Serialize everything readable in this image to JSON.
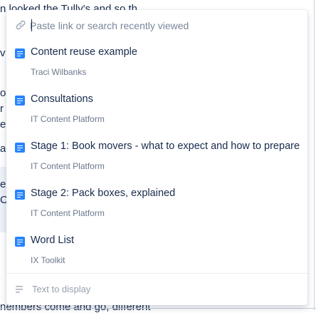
{
  "background": {
    "fragments": [
      {
        "text": "n looked the Tully's and so th"
      },
      {
        "text": "v"
      },
      {
        "text": "o"
      },
      {
        "text": "r"
      },
      {
        "text": "e"
      },
      {
        "text": "a"
      },
      {
        "text": "e,"
      },
      {
        "text": "C"
      },
      {
        "text": "nembers come and go, different"
      }
    ]
  },
  "search": {
    "placeholder": "Paste link or search recently viewed",
    "value": "",
    "icon": "link-icon"
  },
  "results": [
    {
      "title": "Content reuse example",
      "subtitle": "Traci Wilbanks",
      "icon": "page-icon"
    },
    {
      "title": "Consultations",
      "subtitle": "IT Content Platform",
      "icon": "page-icon"
    },
    {
      "title": "Stage 1: Book movers - what to expect and how to prepare",
      "subtitle": "IT Content Platform",
      "icon": "page-icon"
    },
    {
      "title": "Stage 2: Pack boxes, explained",
      "subtitle": "IT Content Platform",
      "icon": "page-icon"
    },
    {
      "title": "Word List",
      "subtitle": "IX Toolkit",
      "icon": "page-icon"
    }
  ],
  "display_text": {
    "placeholder": "Text to display",
    "value": "",
    "icon": "text-lines-icon"
  },
  "colors": {
    "accent": "#2684ff",
    "title": "#172b4d",
    "subtitle": "#6b778c",
    "placeholder": "#7a869a"
  }
}
